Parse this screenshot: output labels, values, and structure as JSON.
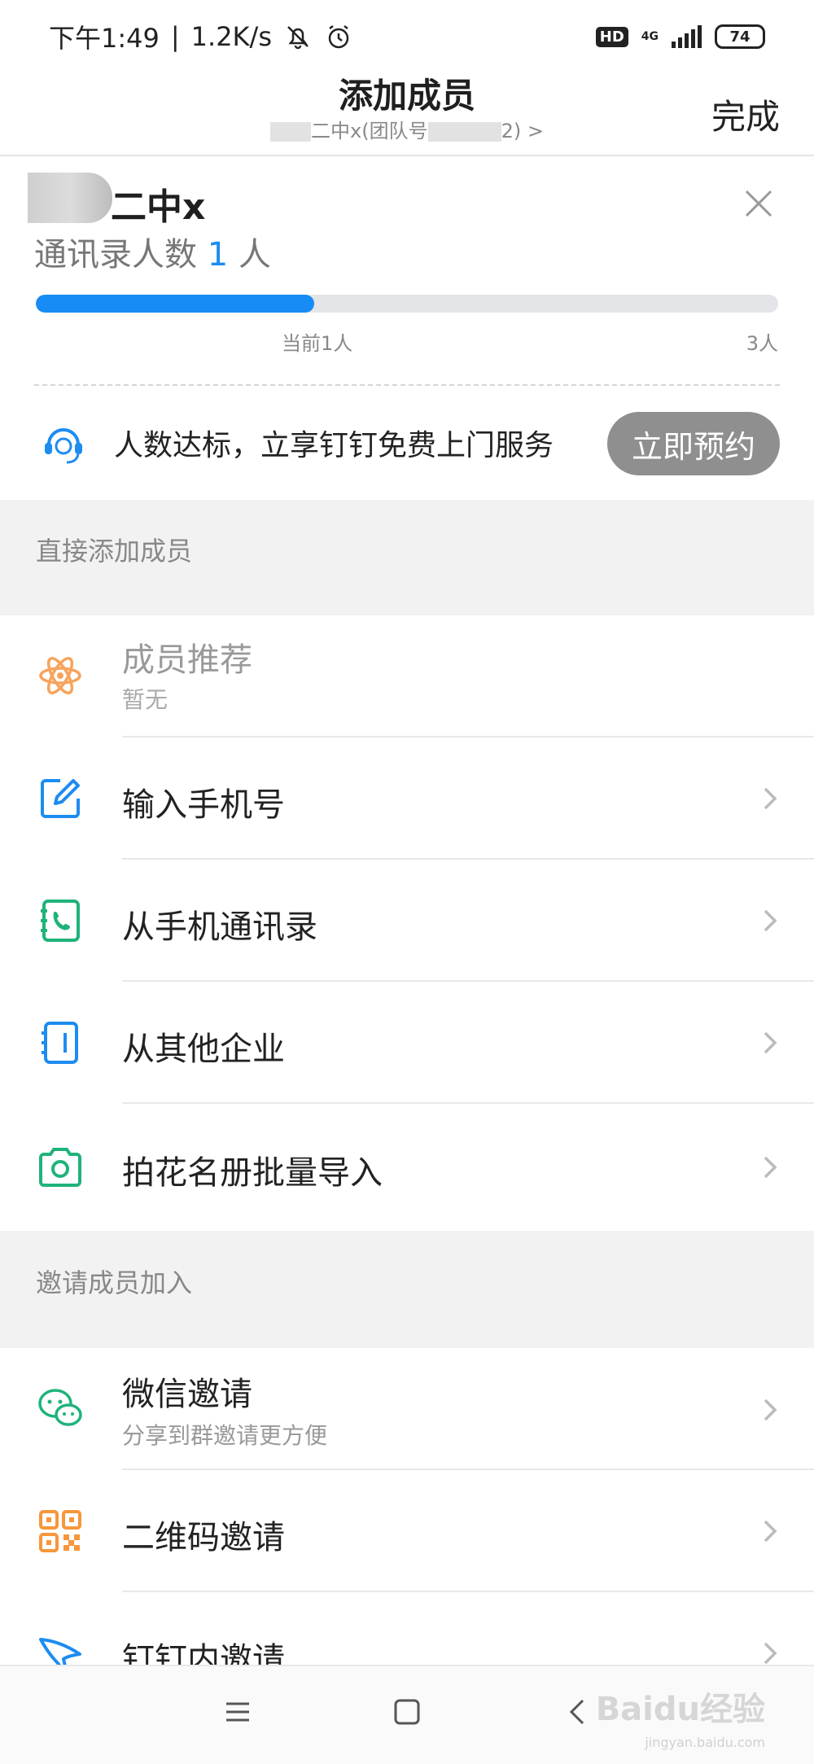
{
  "status_bar": {
    "time": "下午1:49",
    "speed": "1.2K/s",
    "hd": "HD",
    "network": "4G",
    "battery": "74"
  },
  "header": {
    "title": "添加成员",
    "subtitle_name": "二中x(团队号",
    "subtitle_suffix": "2) >",
    "done_label": "完成"
  },
  "org": {
    "name": "二中x",
    "count_prefix": "通讯录人数",
    "count_value": "1",
    "count_unit": "人",
    "progress_current_label": "当前1人",
    "progress_max_label": "3人",
    "progress_fraction": 0.375,
    "service_text": "人数达标，立享钉钉免费上门服务",
    "reserve_label": "立即预约"
  },
  "direct_section": {
    "title": "直接添加成员",
    "items": [
      {
        "label": "成员推荐",
        "sub": "暂无",
        "icon": "atom-icon",
        "color": "#f7a35c"
      },
      {
        "label": "输入手机号",
        "icon": "edit-icon",
        "color": "#1d8cf0"
      },
      {
        "label": "从手机通讯录",
        "icon": "contacts-phone-icon",
        "color": "#1fb37a"
      },
      {
        "label": "从其他企业",
        "icon": "enterprise-icon",
        "color": "#1d8cf0"
      },
      {
        "label": "拍花名册批量导入",
        "icon": "camera-icon",
        "color": "#1fb37a"
      }
    ]
  },
  "invite_section": {
    "title": "邀请成员加入",
    "items": [
      {
        "label": "微信邀请",
        "sub": "分享到群邀请更方便",
        "icon": "wechat-icon",
        "color": "#1fb37a"
      },
      {
        "label": "二维码邀请",
        "icon": "qrcode-icon",
        "color": "#f7963c"
      },
      {
        "label": "钉钉内邀请",
        "icon": "dingtalk-icon",
        "color": "#1d8cf0"
      }
    ]
  },
  "watermark": {
    "text": "Baidu经验",
    "sub": "jingyan.baidu.com"
  }
}
